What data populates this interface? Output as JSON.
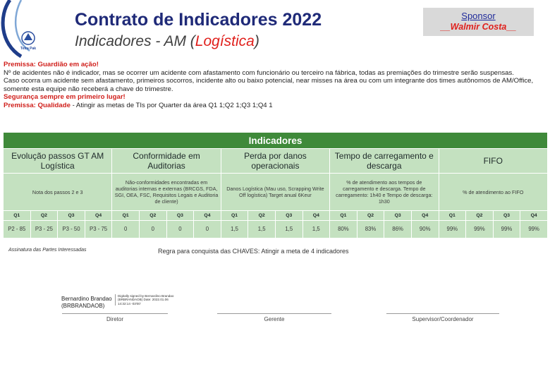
{
  "header": {
    "title": "Contrato de Indicadores 2022",
    "subtitle_prefix": "Indicadores - AM (",
    "subtitle_area": "Logística",
    "subtitle_suffix": ")",
    "logo_text": "Tetra Pak"
  },
  "sponsor": {
    "label": "Sponsor",
    "name": "__Walmir Costa__"
  },
  "premises": [
    {
      "text": "Premissa: Guardião em ação!",
      "style": "red"
    },
    {
      "text": "Nº de acidentes não é indicador, mas se ocorrer um acidente com afastamento com funcionário ou terceiro na fábrica, todas as premiações do trimestre serão suspensas.",
      "style": "normal"
    },
    {
      "text": "Caso ocorra um acidente sem afastamento, primeiros socorros, incidente alto ou baixo potencial, near misses na área ou com um integrante dos times autônomos de AM/Office, somente esta equipe não receberá a chave do trimestre.",
      "style": "normal"
    },
    {
      "text": "Segurança sempre em primeiro lugar!",
      "style": "red"
    }
  ],
  "quality_premise": {
    "label": "Premissa: Qualidade",
    "text": " - Atingir as metas de TIs por Quarter da área Q1 1;Q2 1;Q3 1;Q4 1"
  },
  "table": {
    "title": "Indicadores",
    "quarters": [
      "Q1",
      "Q2",
      "Q3",
      "Q4"
    ],
    "indicators": [
      {
        "name": "Evolução passos GT AM Logística",
        "description": "Nota dos passos 2 e 3",
        "values": [
          "P2 - 85",
          "P3 - 25",
          "P3 - 50",
          "P3 - 75"
        ]
      },
      {
        "name": "Conformidade em Auditorias",
        "description": "Não-conformidades encontradas em auditorias internas e externas (BRCGS, FDA, SGI, OEA, FSC, Requisitos Legais e Auditoria de cliente)",
        "values": [
          "0",
          "0",
          "0",
          "0"
        ]
      },
      {
        "name": "Perda por danos operacionais",
        "description": "Danos Logística (Mau uso, Scrapping Write Off logística) Target anual 6Keur",
        "values": [
          "1,5",
          "1,5",
          "1,5",
          "1,5"
        ]
      },
      {
        "name": "Tempo de carregamento e descarga",
        "description": "% de atendimento aos tempos de carregamento e descarga. Tempo de carregamento: 1h40 e Tempo de descarga: 1h30",
        "values": [
          "80%",
          "83%",
          "86%",
          "90%"
        ]
      },
      {
        "name": "FIFO",
        "description": "% de atendimento ao FIFO",
        "values": [
          "99%",
          "99%",
          "99%",
          "99%"
        ]
      }
    ]
  },
  "footer": {
    "signature_label": "Assinatura das Partes Interessadas",
    "rule": "Regra para conquista das CHAVES: Atingir a meta de 4 indicadores",
    "signer_name": "Bernardino Brandao",
    "signer_id": "(BRBRANDAOB)",
    "digital_sig": "Digitally signed by Bernardino Brandao (BRBRANDAOB) Date: 2022.01.06 14:32:14 -03'00'",
    "roles": [
      "Diretor",
      "Gerente",
      "Supervisor/Coordenador"
    ]
  },
  "colors": {
    "title_blue": "#1f2a78",
    "accent_red": "#e0201c",
    "table_header_green": "#3f8a3a",
    "table_cell_green": "#c4e1c0",
    "sponsor_box": "#d9d9d9"
  }
}
